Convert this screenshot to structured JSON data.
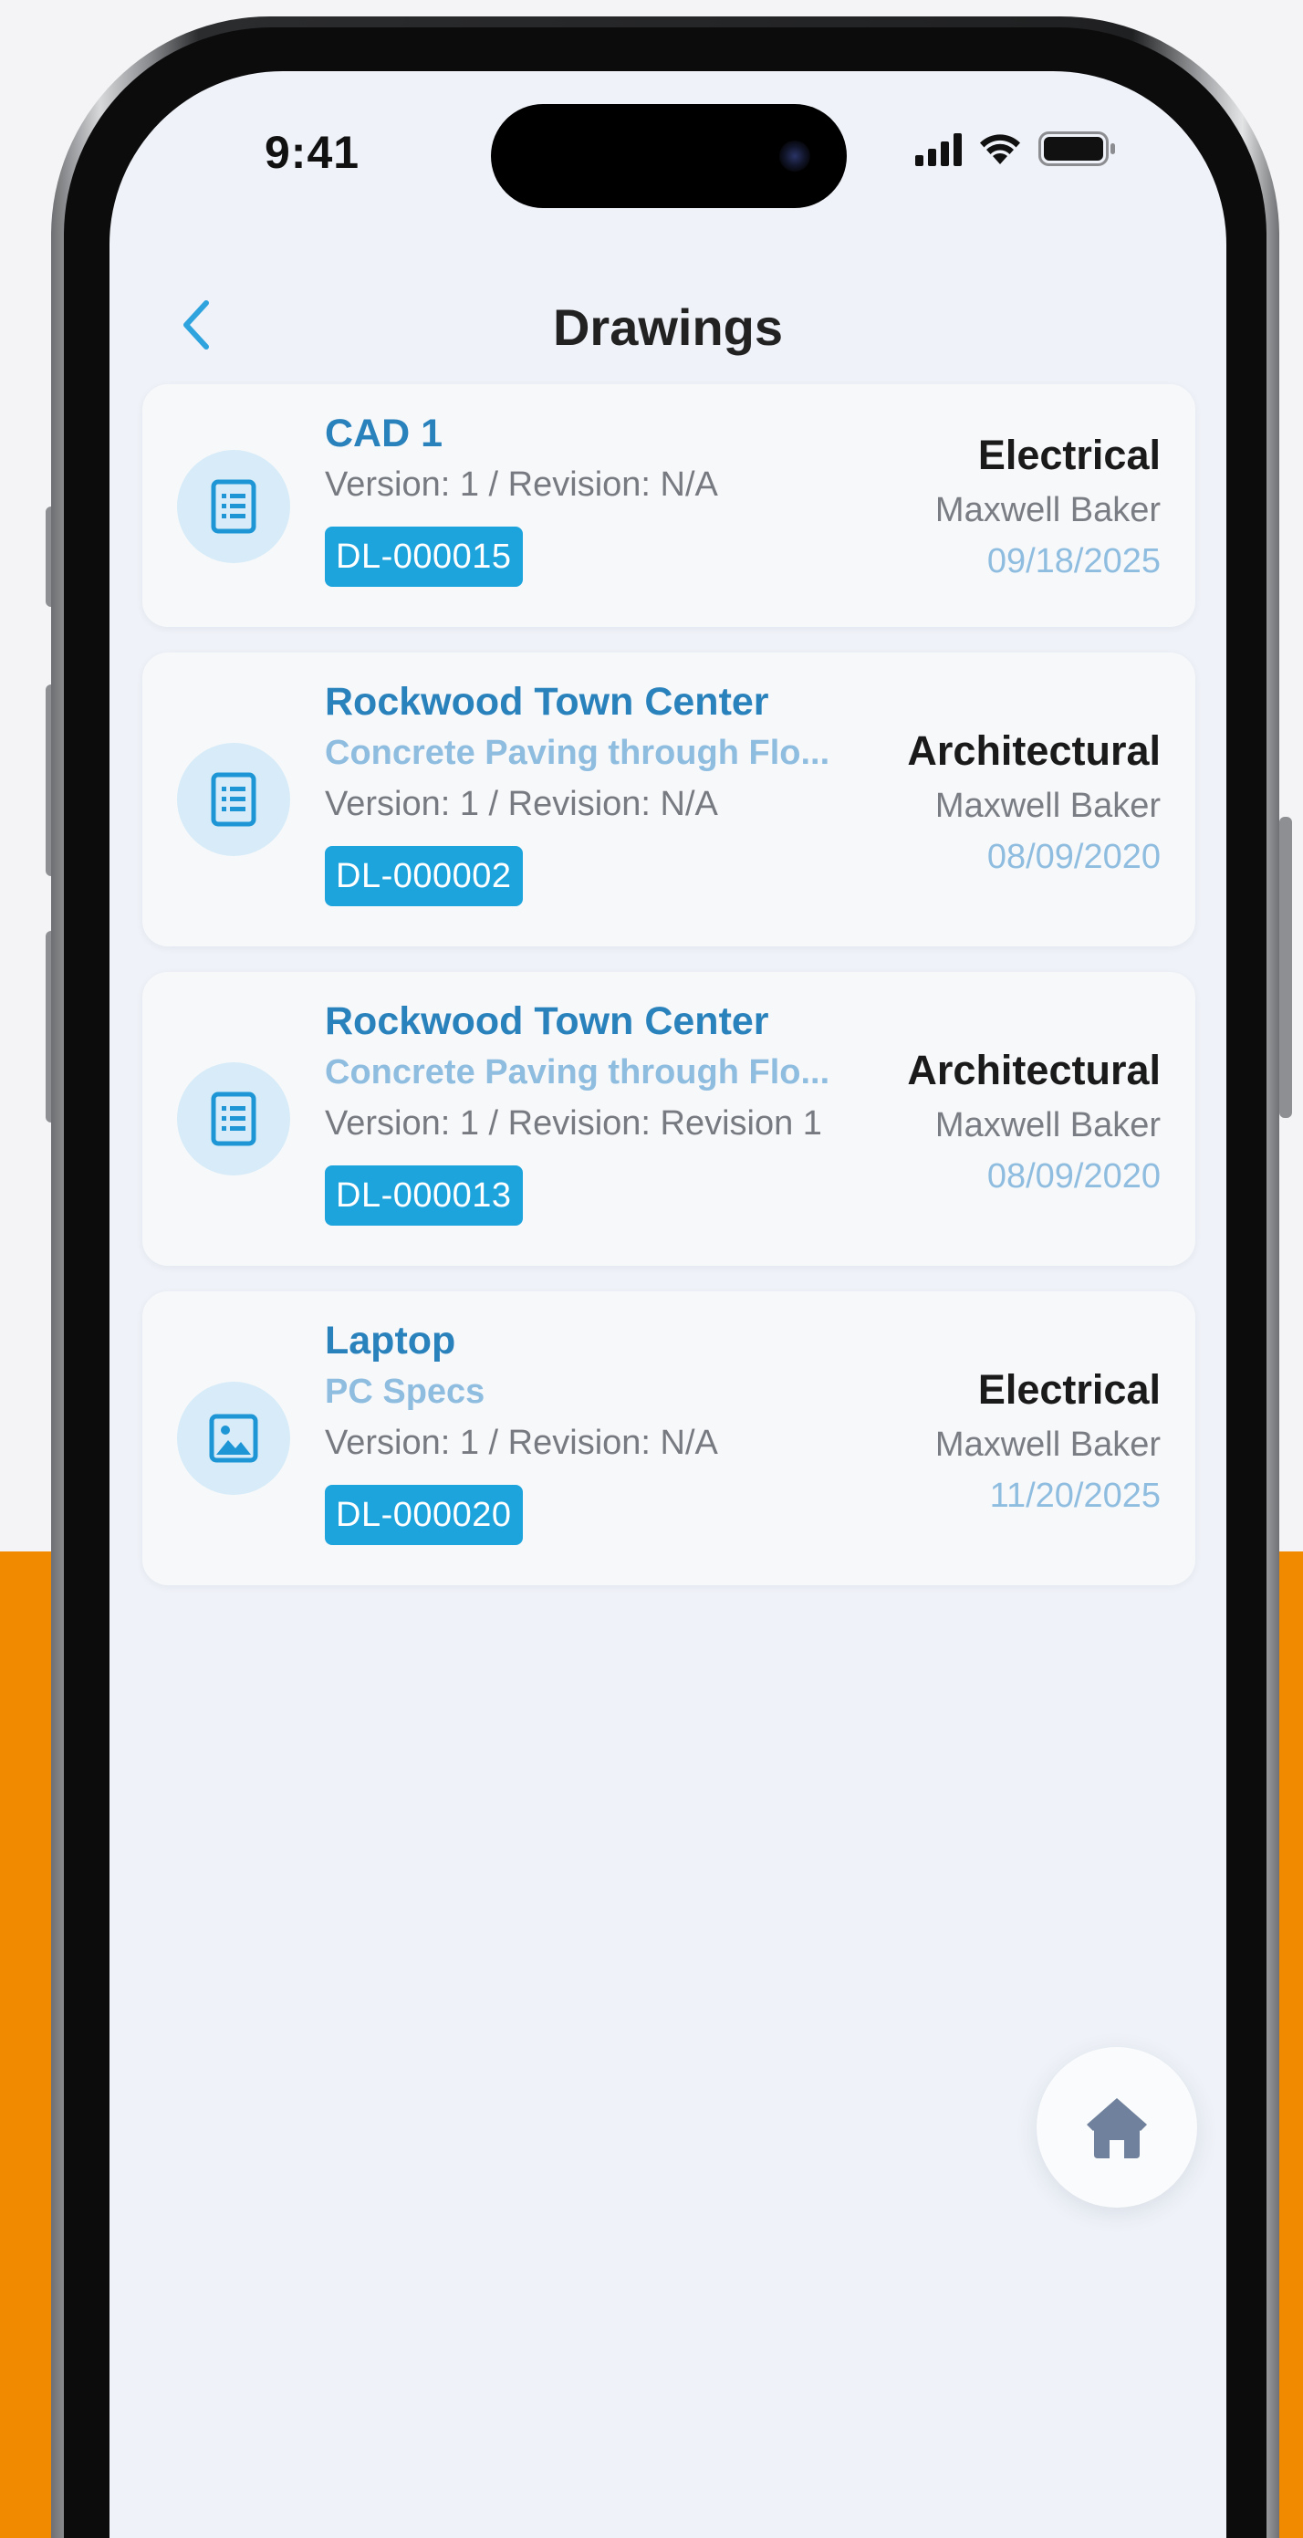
{
  "status_bar": {
    "time": "9:41"
  },
  "nav": {
    "title": "Drawings"
  },
  "drawings": [
    {
      "title": "CAD 1",
      "subtitle": "",
      "version": "Version: 1 / Revision: N/A",
      "id": "DL-000015",
      "discipline": "Electrical",
      "author": "Maxwell Baker",
      "date": "09/18/2025",
      "icon": "document-icon"
    },
    {
      "title": "Rockwood Town Center",
      "subtitle": "Concrete Paving through Flo...",
      "version": "Version: 1 / Revision: N/A",
      "id": "DL-000002",
      "discipline": "Architectural",
      "author": "Maxwell Baker",
      "date": "08/09/2020",
      "icon": "document-icon"
    },
    {
      "title": "Rockwood Town Center",
      "subtitle": "Concrete Paving through Flo...",
      "version": "Version: 1 / Revision: Revision 1",
      "id": "DL-000013",
      "discipline": "Architectural",
      "author": "Maxwell Baker",
      "date": "08/09/2020",
      "icon": "document-icon"
    },
    {
      "title": "Laptop",
      "subtitle": "PC Specs",
      "version": "Version: 1 / Revision: N/A",
      "id": "DL-000020",
      "discipline": "Electrical",
      "author": "Maxwell Baker",
      "date": "11/20/2025",
      "icon": "image-icon"
    }
  ],
  "colors": {
    "accent": "#1ea4dd",
    "title": "#2a82bc",
    "background_orange": "#f28a00"
  }
}
